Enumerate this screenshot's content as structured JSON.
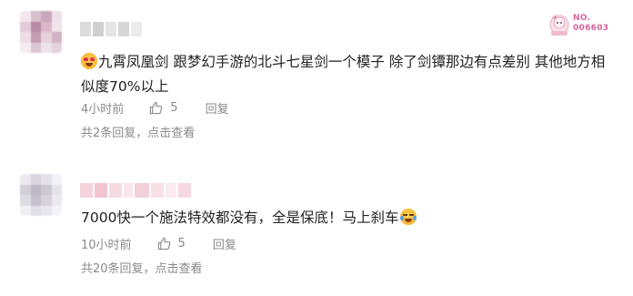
{
  "comments": [
    {
      "content": "九霄凤凰剑 跟梦幻手游的北斗七星剑一个模子 除了剑镡那边有点差别 其他地方相似度70%以上",
      "time": "4小时前",
      "likes": "5",
      "reply_label": "回复",
      "replies_summary": "共2条回复，点击查看",
      "emoji": "heart-eyes-emoji",
      "badge_text": "NO.\n006603"
    },
    {
      "content": "7000快一个施法特效都没有，全是保底！马上刹车",
      "time": "10小时前",
      "likes": "5",
      "reply_label": "回复",
      "replies_summary": "共20条回复，点击查看",
      "emoji": "laughing-tears-emoji"
    }
  ],
  "colors": {
    "text": "#222222",
    "meta": "#8a8a8a",
    "badge": "#d4639a"
  }
}
